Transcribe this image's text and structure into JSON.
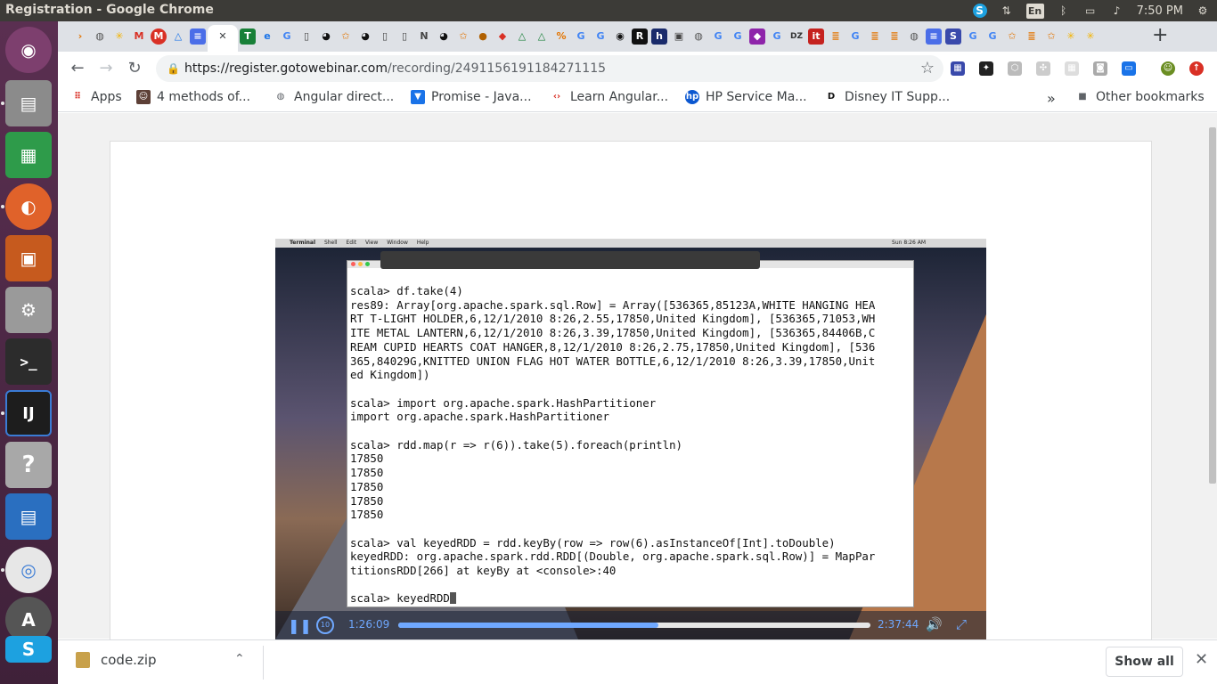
{
  "os_bar": {
    "window_title": "Registration - Google Chrome",
    "language": "En",
    "time": "7:50 PM"
  },
  "launcher": {
    "apps": [
      "ubuntu-dash",
      "files",
      "libreoffice-calc",
      "firefox",
      "libreoffice-impress",
      "system-settings",
      "terminal",
      "intellij-idea",
      "help",
      "libreoffice-writer",
      "google-chrome",
      "software-updater",
      "skype"
    ]
  },
  "browser": {
    "url_host": "https://register.gotowebinar.com",
    "url_path": "/recording/2491156191184271115",
    "new_tab_label": "+",
    "bookmarks": [
      {
        "label": "Apps",
        "icon": "apps-grid-icon"
      },
      {
        "label": "4 methods of...",
        "icon": "avatar-icon"
      },
      {
        "label": "Angular direct...",
        "icon": "globe-icon"
      },
      {
        "label": "Promise - Java...",
        "icon": "mdn-icon"
      },
      {
        "label": "Learn Angular...",
        "icon": "code-icon"
      },
      {
        "label": "HP Service Ma...",
        "icon": "hp-icon"
      },
      {
        "label": "Disney IT Supp...",
        "icon": "disney-icon"
      }
    ],
    "bookmarks_overflow": "»",
    "other_bookmarks": "Other bookmarks"
  },
  "video": {
    "mac_menu": [
      "Terminal",
      "Shell",
      "Edit",
      "View",
      "Window",
      "Help"
    ],
    "mac_clock": "Sun 8:26 AM",
    "terminal_lines": [
      "scala> df.take(4)",
      "res89: Array[org.apache.spark.sql.Row] = Array([536365,85123A,WHITE HANGING HEA",
      "RT T-LIGHT HOLDER,6,12/1/2010 8:26,2.55,17850,United Kingdom], [536365,71053,WH",
      "ITE METAL LANTERN,6,12/1/2010 8:26,3.39,17850,United Kingdom], [536365,84406B,C",
      "REAM CUPID HEARTS COAT HANGER,8,12/1/2010 8:26,2.75,17850,United Kingdom], [536",
      "365,84029G,KNITTED UNION FLAG HOT WATER BOTTLE,6,12/1/2010 8:26,3.39,17850,Unit",
      "ed Kingdom])",
      "",
      "scala> import org.apache.spark.HashPartitioner",
      "import org.apache.spark.HashPartitioner",
      "",
      "scala> rdd.map(r => r(6)).take(5).foreach(println)",
      "17850",
      "17850",
      "17850",
      "17850",
      "17850",
      "",
      "scala> val keyedRDD = rdd.keyBy(row => row(6).asInstanceOf[Int].toDouble)",
      "keyedRDD: org.apache.spark.rdd.RDD[(Double, org.apache.spark.sql.Row)] = MapPar",
      "titionsRDD[266] at keyBy at <console>:40",
      "",
      "scala> keyedRDD"
    ],
    "current_time": "1:26:09",
    "duration": "2:37:44",
    "progress_fraction": 0.55
  },
  "downloads": {
    "file_name": "code.zip",
    "show_all": "Show all"
  }
}
